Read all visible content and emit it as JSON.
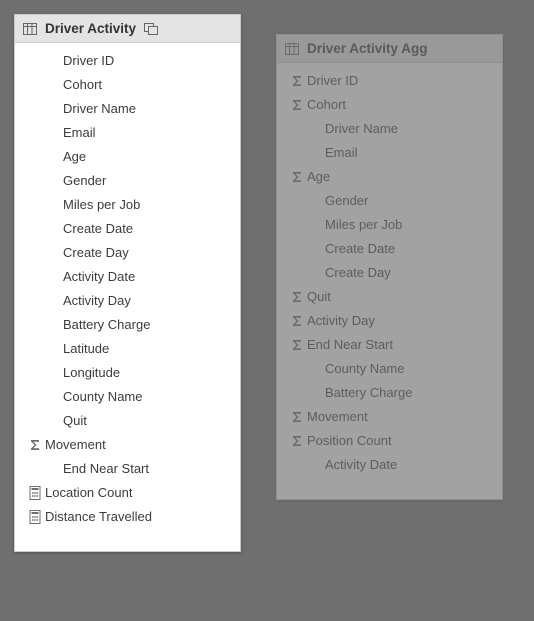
{
  "panels": [
    {
      "title": "Driver Activity",
      "ghost": false,
      "show_overlay_icon": true,
      "fields": [
        {
          "icon": "",
          "indent": true,
          "label": "Driver ID"
        },
        {
          "icon": "",
          "indent": true,
          "label": "Cohort"
        },
        {
          "icon": "",
          "indent": true,
          "label": "Driver Name"
        },
        {
          "icon": "",
          "indent": true,
          "label": "Email"
        },
        {
          "icon": "",
          "indent": true,
          "label": "Age"
        },
        {
          "icon": "",
          "indent": true,
          "label": "Gender"
        },
        {
          "icon": "",
          "indent": true,
          "label": "Miles per Job"
        },
        {
          "icon": "",
          "indent": true,
          "label": "Create Date"
        },
        {
          "icon": "",
          "indent": true,
          "label": "Create Day"
        },
        {
          "icon": "",
          "indent": true,
          "label": "Activity Date"
        },
        {
          "icon": "",
          "indent": true,
          "label": "Activity Day"
        },
        {
          "icon": "",
          "indent": true,
          "label": "Battery Charge"
        },
        {
          "icon": "",
          "indent": true,
          "label": "Latitude"
        },
        {
          "icon": "",
          "indent": true,
          "label": "Longitude"
        },
        {
          "icon": "",
          "indent": true,
          "label": "County Name"
        },
        {
          "icon": "",
          "indent": true,
          "label": "Quit"
        },
        {
          "icon": "sigma",
          "indent": false,
          "label": "Movement"
        },
        {
          "icon": "",
          "indent": true,
          "label": "End Near Start"
        },
        {
          "icon": "calc",
          "indent": false,
          "label": "Location Count"
        },
        {
          "icon": "calc",
          "indent": false,
          "label": "Distance Travelled"
        }
      ]
    },
    {
      "title": "Driver Activity Agg",
      "ghost": true,
      "show_overlay_icon": false,
      "fields": [
        {
          "icon": "sigma",
          "indent": false,
          "label": "Driver ID"
        },
        {
          "icon": "sigma",
          "indent": false,
          "label": "Cohort"
        },
        {
          "icon": "",
          "indent": true,
          "label": "Driver Name"
        },
        {
          "icon": "",
          "indent": true,
          "label": "Email"
        },
        {
          "icon": "sigma",
          "indent": false,
          "label": "Age"
        },
        {
          "icon": "",
          "indent": true,
          "label": "Gender"
        },
        {
          "icon": "",
          "indent": true,
          "label": "Miles per Job"
        },
        {
          "icon": "",
          "indent": true,
          "label": "Create Date"
        },
        {
          "icon": "",
          "indent": true,
          "label": "Create Day"
        },
        {
          "icon": "sigma",
          "indent": false,
          "label": "Quit"
        },
        {
          "icon": "sigma",
          "indent": false,
          "label": "Activity Day"
        },
        {
          "icon": "sigma",
          "indent": false,
          "label": "End Near Start"
        },
        {
          "icon": "",
          "indent": true,
          "label": "County Name"
        },
        {
          "icon": "",
          "indent": true,
          "label": "Battery Charge"
        },
        {
          "icon": "sigma",
          "indent": false,
          "label": "Movement"
        },
        {
          "icon": "sigma",
          "indent": false,
          "label": "Position Count"
        },
        {
          "icon": "",
          "indent": true,
          "label": "Activity Date"
        }
      ]
    }
  ]
}
